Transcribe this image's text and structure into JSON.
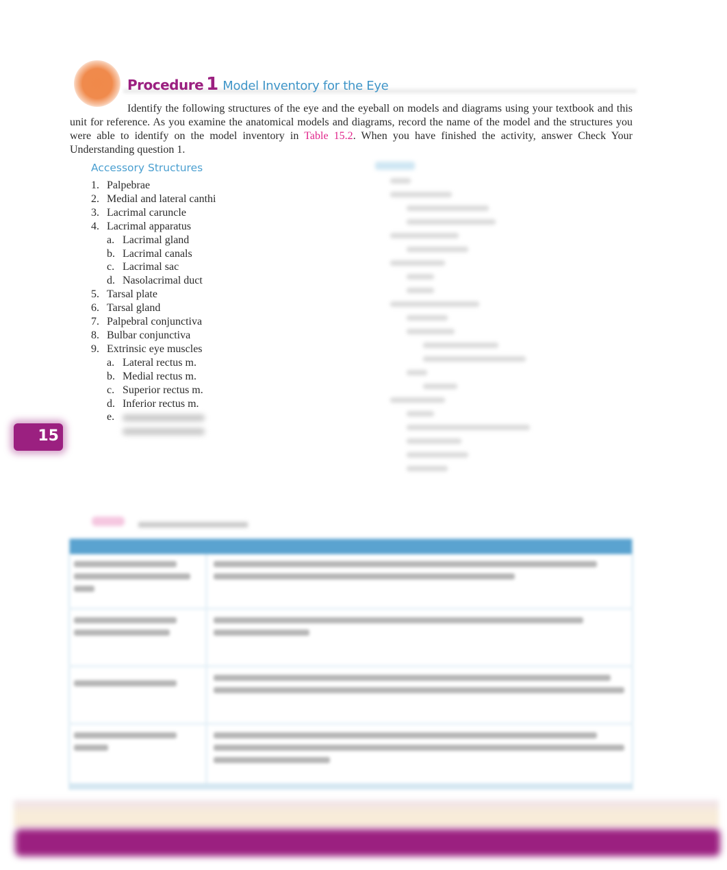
{
  "procedure": {
    "label": "Procedure",
    "number": "1",
    "title": "Model Inventory for the Eye",
    "intro_before_ref": "Identify the following structures of the eye and the eyeball on models and diagrams using your textbook and this unit for reference. As you examine the anatomical models and diagrams, record the name of the model and the structures you were able to identify on the model inventory in ",
    "intro_ref": "Table 15.2",
    "intro_after_ref": ". When you have finished the activity, answer Check Your Understanding question 1."
  },
  "accessory": {
    "heading": "Accessory Structures",
    "items": [
      {
        "n": "1.",
        "label": "Palpebrae"
      },
      {
        "n": "2.",
        "label": "Medial and lateral canthi"
      },
      {
        "n": "3.",
        "label": "Lacrimal caruncle"
      },
      {
        "n": "4.",
        "label": "Lacrimal apparatus"
      },
      {
        "n": "a.",
        "label": "Lacrimal gland"
      },
      {
        "n": "b.",
        "label": "Lacrimal canals"
      },
      {
        "n": "c.",
        "label": "Lacrimal sac"
      },
      {
        "n": "d.",
        "label": "Nasolacrimal duct"
      },
      {
        "n": "5.",
        "label": "Tarsal plate"
      },
      {
        "n": "6.",
        "label": "Tarsal gland"
      },
      {
        "n": "7.",
        "label": "Palpebral conjunctiva"
      },
      {
        "n": "8.",
        "label": "Bulbar conjunctiva"
      },
      {
        "n": "9.",
        "label": "Extrinsic eye muscles"
      },
      {
        "n": "a.",
        "label": "Lateral rectus m."
      },
      {
        "n": "b.",
        "label": "Medial rectus m."
      },
      {
        "n": "c.",
        "label": "Superior rectus m."
      },
      {
        "n": "d.",
        "label": "Inferior rectus m."
      },
      {
        "n": "e.",
        "label": ""
      }
    ]
  },
  "chapter_tab": "15",
  "colors": {
    "procedure_purple": "#9b2080",
    "subtitle_blue": "#3f95c8",
    "reference_pink": "#e0248a",
    "table_header_blue": "#5aa3d0",
    "accent_orange": "#f08a4c"
  }
}
